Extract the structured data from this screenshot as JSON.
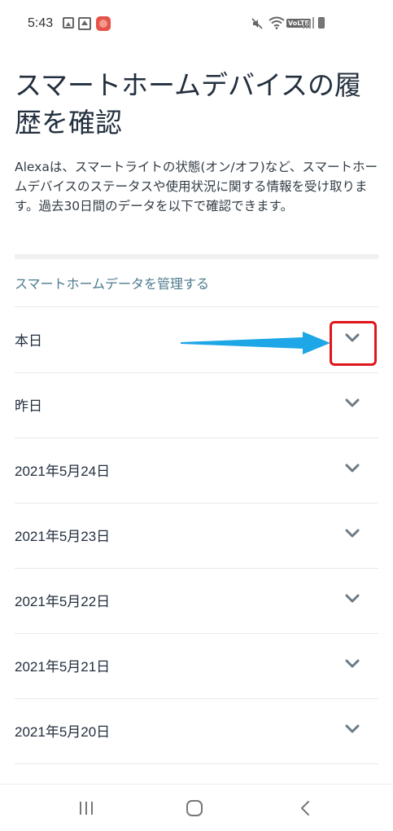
{
  "status_bar": {
    "time": "5:43",
    "notification_icons": [
      "gallery-icon",
      "home-photo-icon",
      "app-icon"
    ],
    "system_icons": [
      "mute-icon",
      "wifi-icon",
      "volte-badge",
      "signal-icon",
      "battery-icon"
    ],
    "volte_label": "VoLTE"
  },
  "page": {
    "title": "スマートホームデバイスの履歴を確認",
    "description": "Alexaは、スマートライトの状態(オン/オフ)など、スマートホームデバイスのステータスや使用状況に関する情報を受け取ります。過去30日間のデータを以下で確認できます。",
    "manage_link": "スマートホームデータを管理する"
  },
  "days": [
    {
      "label": "本日"
    },
    {
      "label": "昨日"
    },
    {
      "label": "2021年5月24日"
    },
    {
      "label": "2021年5月23日"
    },
    {
      "label": "2021年5月22日"
    },
    {
      "label": "2021年5月21日"
    },
    {
      "label": "2021年5月20日"
    }
  ],
  "annotation": {
    "arrow_color": "#1ea7e6",
    "box_color": "#e0151c"
  },
  "nav_bar": {
    "buttons": [
      "recent-apps-icon",
      "home-icon",
      "back-icon"
    ]
  },
  "colors": {
    "title": "#232f3e",
    "link": "#4d7a8c",
    "chevron": "#6b7b86"
  }
}
